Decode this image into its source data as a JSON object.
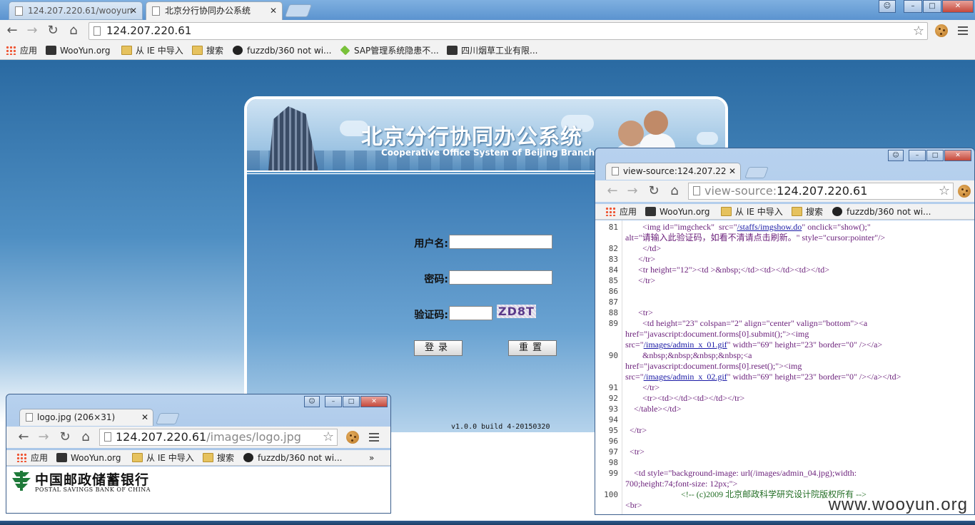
{
  "browser": {
    "tabs": [
      {
        "title": "124.207.220.61/wooyun",
        "active": false
      },
      {
        "title": "北京分行协同办公系统",
        "active": true
      }
    ],
    "window_controls": {
      "user": "☺",
      "minimize": "–",
      "maximize": "□",
      "close": "✕"
    },
    "url": "124.207.220.61",
    "bookmarks": [
      "应用",
      "WooYun.org",
      "从 IE 中导入",
      "搜索",
      "fuzzdb/360 not wi...",
      "SAP管理系统隐患不...",
      "四川烟草工业有限..."
    ]
  },
  "login_page": {
    "title": "北京分行协同办公系统",
    "subtitle": "Cooperative Office System of Beijing Branch",
    "username_label": "用户名:",
    "password_label": "密码:",
    "captcha_label": "验证码:",
    "captcha_text": "ZD8T",
    "login_button": "登录",
    "reset_button": "重置",
    "version": "v1.0.0 build 4-20150320"
  },
  "source_window": {
    "tab_title": "view-source:124.207.22",
    "url_prefix": "view-source:",
    "url": "124.207.220.61",
    "bookmarks": [
      "应用",
      "WooYun.org",
      "从 IE 中导入",
      "搜索",
      "fuzzdb/360 not wi..."
    ],
    "lines": [
      {
        "n": "81",
        "text": "        <img id=\"imgcheck\"  src=\"/staffs/imgshow.do\" onclick=\"show();\""
      },
      {
        "n": "",
        "text": "alt=\"请输入此验证码，如看不清请点击刷新。\" style=\"cursor:pointer\"/>"
      },
      {
        "n": "82",
        "text": "        </td>"
      },
      {
        "n": "83",
        "text": "      </tr>"
      },
      {
        "n": "84",
        "text": "      <tr height=\"12\"><td >&nbsp;</td><td></td><td></td>"
      },
      {
        "n": "85",
        "text": "      </tr>"
      },
      {
        "n": "86",
        "text": ""
      },
      {
        "n": "87",
        "text": ""
      },
      {
        "n": "88",
        "text": "      <tr>"
      },
      {
        "n": "89",
        "text": "        <td height=\"23\" colspan=\"2\" align=\"center\" valign=\"bottom\"><a"
      },
      {
        "n": "",
        "text": "href=\"javascript:document.forms[0].submit();\"><img"
      },
      {
        "n": "",
        "text": "src=\"/images/admin_x_01.gif\" width=\"69\" height=\"23\" border=\"0\" /></a>"
      },
      {
        "n": "90",
        "text": "        &nbsp;&nbsp;&nbsp;&nbsp;<a"
      },
      {
        "n": "",
        "text": "href=\"javascript:document.forms[0].reset();\"><img"
      },
      {
        "n": "",
        "text": "src=\"/images/admin_x_02.gif\" width=\"69\" height=\"23\" border=\"0\" /></a></td>"
      },
      {
        "n": "91",
        "text": "        </tr>"
      },
      {
        "n": "92",
        "text": "        <tr><td></td><td></td></tr>"
      },
      {
        "n": "93",
        "text": "    </table></td>"
      },
      {
        "n": "94",
        "text": ""
      },
      {
        "n": "95",
        "text": "  </tr>"
      },
      {
        "n": "96",
        "text": ""
      },
      {
        "n": "97",
        "text": "  <tr>"
      },
      {
        "n": "98",
        "text": ""
      },
      {
        "n": "99",
        "text": "    <td style=\"background-image: url(/images/admin_04.jpg);width:"
      },
      {
        "n": "",
        "text": "700;height:74;font-size: 12px;\">"
      },
      {
        "n": "100",
        "text": "                          <!-- (c)2009 北京邮政科学研究设计院版权所有 -->"
      },
      {
        "n": "",
        "text": "<br>"
      }
    ]
  },
  "logo_window": {
    "tab_title": "logo.jpg (206×31)",
    "url_host": "124.207.220.61",
    "url_path": "/images/logo.jpg",
    "bookmarks": [
      "应用",
      "WooYun.org",
      "从 IE 中导入",
      "搜索",
      "fuzzdb/360 not wi...",
      "»"
    ],
    "logo_cn": "中国邮政储蓄银行",
    "logo_en": "POSTAL SAVINGS BANK OF CHINA"
  },
  "watermark": "www.wooyun.org",
  "colors": {
    "page_blue": "#2b6fa8",
    "link": "#1a1aa6",
    "tag": "#7b1e8a",
    "comment": "#236e25"
  }
}
